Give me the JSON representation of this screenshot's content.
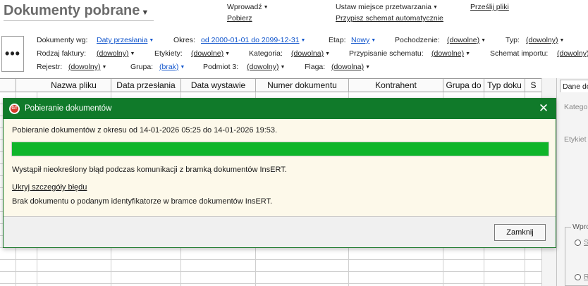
{
  "header": {
    "title": "Dokumenty pobrane",
    "actions": {
      "wprowadz": "Wprowadź",
      "pobierz": "Pobierz",
      "ustaw_miejsce": "Ustaw miejsce przetwarzania",
      "przypisz_schemat": "Przypisz schemat automatycznie",
      "przeslij_pliki": "Prześlij pliki"
    }
  },
  "filters": {
    "more_button": "•••",
    "dokumenty_wg": {
      "label": "Dokumenty wg:",
      "value": "Daty przesłania"
    },
    "okres": {
      "label": "Okres:",
      "value": "od 2000-01-01 do 2099-12-31"
    },
    "etap": {
      "label": "Etap:",
      "value": "Nowy"
    },
    "pochodzenie": {
      "label": "Pochodzenie:",
      "value": "(dowolne)"
    },
    "typ": {
      "label": "Typ:",
      "value": "(dowolny)"
    },
    "rodzaj_faktury": {
      "label": "Rodzaj faktury:",
      "value": "(dowolny)"
    },
    "etykiety": {
      "label": "Etykiety:",
      "value": "(dowolne)"
    },
    "kategoria": {
      "label": "Kategoria:",
      "value": "(dowolna)"
    },
    "przypisanie_schematu": {
      "label": "Przypisanie schematu:",
      "value": "(dowolne)"
    },
    "schemat_importu": {
      "label": "Schemat importu:",
      "value": "(dowolny)"
    },
    "rejestr": {
      "label": "Rejestr:",
      "value": "(dowolny)"
    },
    "grupa": {
      "label": "Grupa:",
      "value": "(brak)"
    },
    "podmiot3": {
      "label": "Podmiot 3:",
      "value": "(dowolny)"
    },
    "flaga": {
      "label": "Flaga:",
      "value": "(dowolna)"
    }
  },
  "grid": {
    "columns": [
      "Nazwa pliku",
      "Data przesłania",
      "Data wystawie",
      "Numer dokumentu",
      "Kontrahent",
      "Grupa do",
      "Typ doku",
      "S"
    ]
  },
  "side_panel": {
    "tab": "Dane do",
    "kategoria_label": "Katego",
    "etykiety_label": "Etykiet",
    "group_label": "Wpro",
    "radio1_label": "S",
    "radio2_label": "R"
  },
  "dialog": {
    "title": "Pobieranie dokumentów",
    "period_text": "Pobieranie dokumentów z okresu od 14-01-2026 05:25 do 14-01-2026 19:53.",
    "progress_percent": 100,
    "error_text": "Wystąpił nieokreślony błąd podczas komunikacji z bramką dokumentów InsERT.",
    "details_link": "Ukryj szczegóły błędu",
    "details_text": "Brak dokumentu o podanym identyfikatorze w bramce dokumentów InsERT.",
    "close_button": "Zamknij",
    "logo_text": "GT"
  },
  "colors": {
    "dialog_title_bg": "#107a2a",
    "progress_fill": "#0fb52a",
    "dialog_body_bg": "#fdf9ea",
    "link_blue": "#1155cc"
  }
}
